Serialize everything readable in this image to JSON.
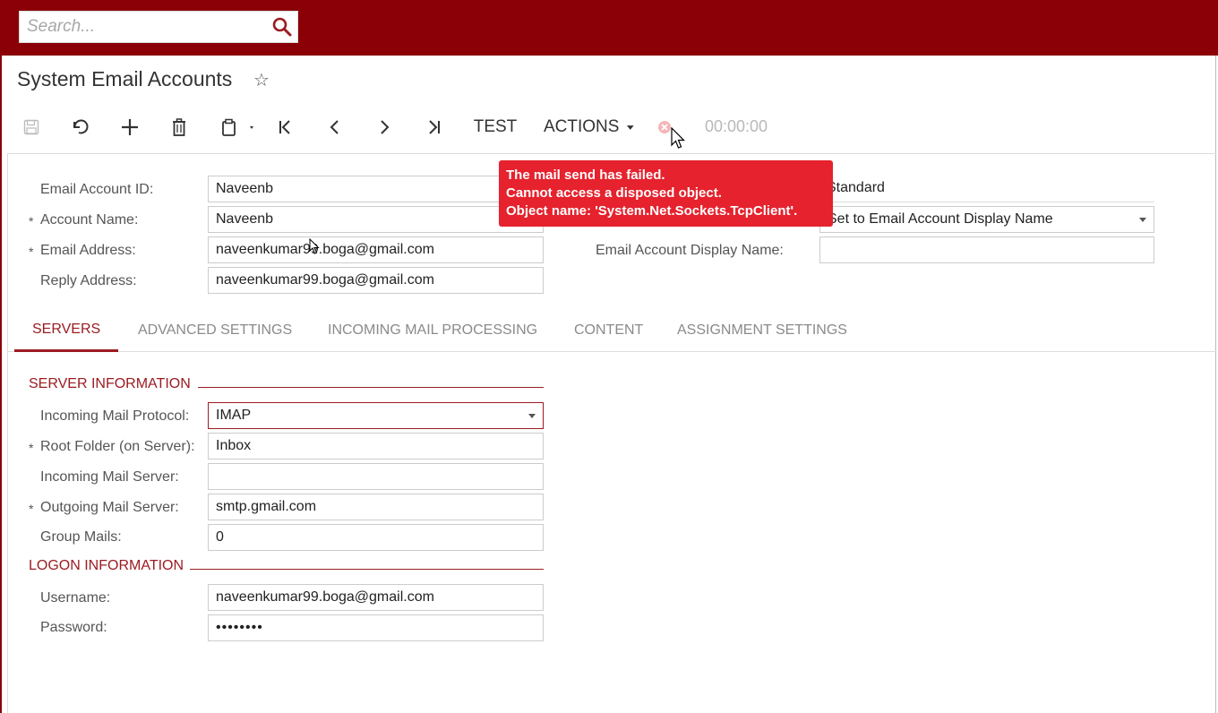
{
  "search": {
    "placeholder": "Search..."
  },
  "page": {
    "title": "System Email Accounts"
  },
  "toolbar": {
    "test_label": "TEST",
    "actions_label": "ACTIONS",
    "timer": "00:00:00"
  },
  "toast": {
    "lines": [
      "The mail send has failed.",
      "Cannot access a disposed object.",
      "Object name: 'System.Net.Sockets.TcpClient'."
    ]
  },
  "form": {
    "email_account_id": {
      "label": "Email Account ID:",
      "value": "Naveenb"
    },
    "account_name": {
      "label": "Account Name:",
      "value": "Naveenb",
      "required": true
    },
    "email_address": {
      "label": "Email Address:",
      "value": "naveenkumar99.boga@gmail.com",
      "required": true
    },
    "reply_address": {
      "label": "Reply Address:",
      "value": "naveenkumar99.boga@gmail.com"
    },
    "account_type_value": "Standard",
    "sender_display_value": "Set to Email Account Display Name",
    "display_name": {
      "label": "Email Account Display Name:",
      "value": ""
    }
  },
  "tabs": [
    {
      "label": "SERVERS",
      "active": true
    },
    {
      "label": "ADVANCED SETTINGS",
      "active": false
    },
    {
      "label": "INCOMING MAIL PROCESSING",
      "active": false
    },
    {
      "label": "CONTENT",
      "active": false
    },
    {
      "label": "ASSIGNMENT SETTINGS",
      "active": false
    }
  ],
  "servers": {
    "server_info_title": "SERVER INFORMATION",
    "incoming_protocol": {
      "label": "Incoming Mail Protocol:",
      "value": "IMAP"
    },
    "root_folder": {
      "label": "Root Folder (on Server):",
      "value": "Inbox",
      "required": true
    },
    "incoming_server": {
      "label": "Incoming Mail Server:",
      "value": ""
    },
    "outgoing_server": {
      "label": "Outgoing Mail Server:",
      "value": "smtp.gmail.com",
      "required": true
    },
    "group_mails": {
      "label": "Group Mails:",
      "value": "0"
    },
    "logon_info_title": "LOGON INFORMATION",
    "username": {
      "label": "Username:",
      "value": "naveenkumar99.boga@gmail.com"
    },
    "password": {
      "label": "Password:",
      "value": "••••••••"
    }
  },
  "colors": {
    "header": "#8b0007",
    "accent": "#9b1c22",
    "toast": "#e5222d"
  }
}
